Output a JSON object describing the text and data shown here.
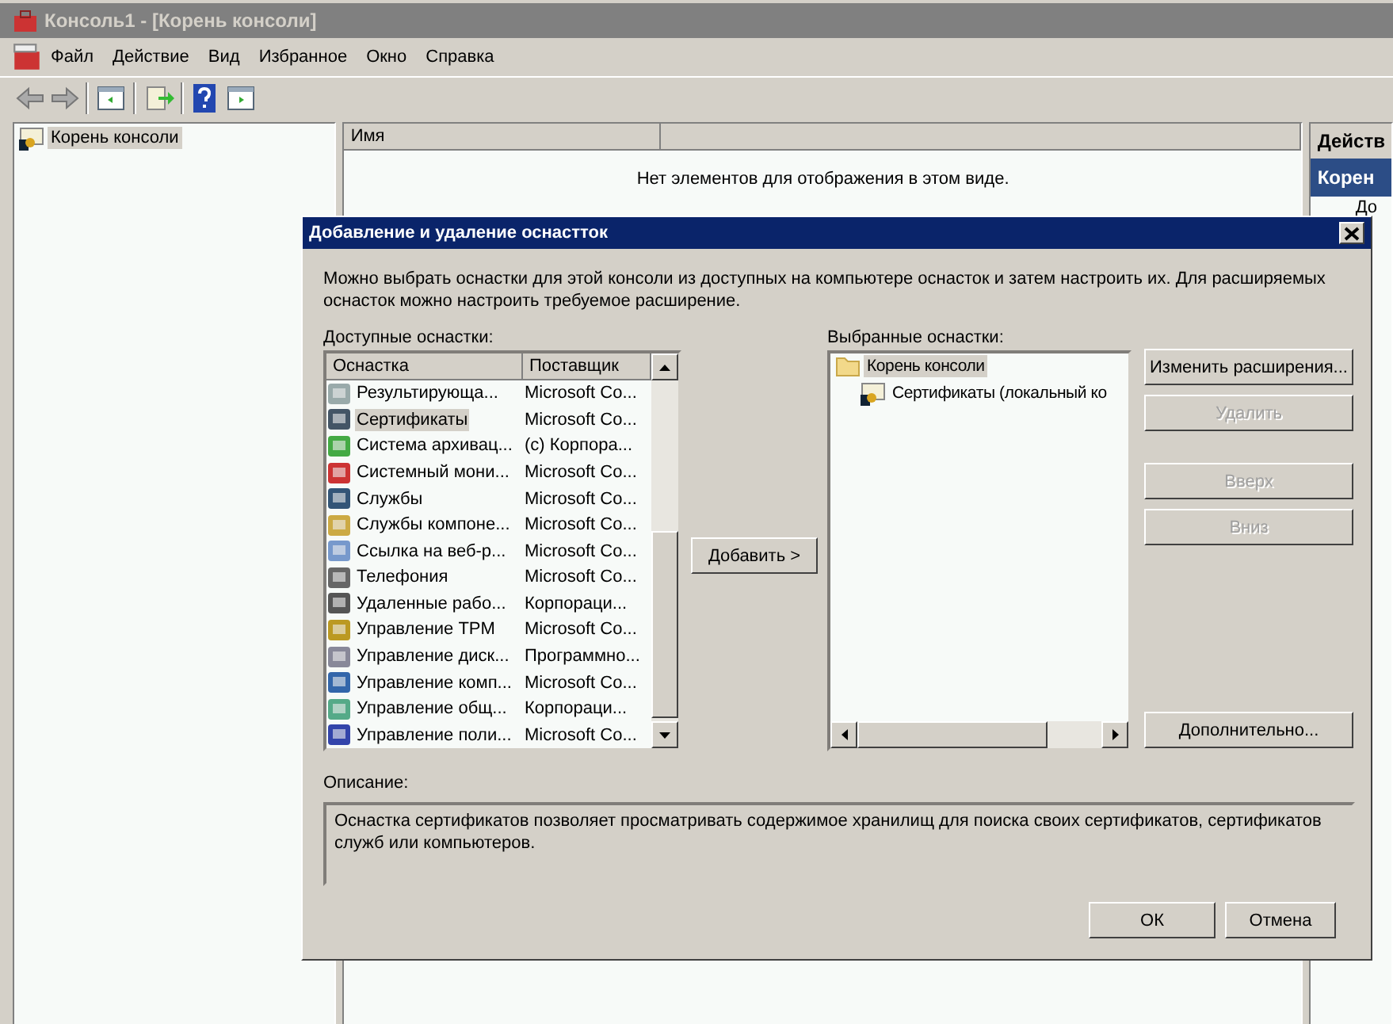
{
  "window": {
    "title": "Консоль1 - [Корень консоли]"
  },
  "menu": [
    "Файл",
    "Действие",
    "Вид",
    "Избранное",
    "Окно",
    "Справка"
  ],
  "tree": [
    {
      "label": "Корень консоли",
      "selected": true
    }
  ],
  "list": {
    "columns": [
      "Имя"
    ],
    "empty_message": "Нет элементов для отображения в этом виде."
  },
  "actions": {
    "title": "Действ",
    "section": "Корен",
    "item": "До"
  },
  "dialog": {
    "title": "Добавление и удаление оснастток",
    "intro": "Можно выбрать оснастки для этой консоли из доступных на компьютере оснасток и затем настроить их. Для расширяемых оснасток можно настроить требуемое расширение.",
    "available_label": "Доступные оснастки:",
    "available_columns": [
      "Оснастка",
      "Поставщик"
    ],
    "available": [
      {
        "name": "Результирующа...",
        "vendor": "Microsoft Co...",
        "selected": false
      },
      {
        "name": "Сертификаты",
        "vendor": "Microsoft Co...",
        "selected": true
      },
      {
        "name": "Система архивац...",
        "vendor": "(c) Корпора...",
        "selected": false
      },
      {
        "name": "Системный мони...",
        "vendor": "Microsoft Co...",
        "selected": false
      },
      {
        "name": "Службы",
        "vendor": "Microsoft Co...",
        "selected": false
      },
      {
        "name": "Службы компоне...",
        "vendor": "Microsoft Co...",
        "selected": false
      },
      {
        "name": "Ссылка на веб-р...",
        "vendor": "Microsoft Co...",
        "selected": false
      },
      {
        "name": "Телефония",
        "vendor": "Microsoft Co...",
        "selected": false
      },
      {
        "name": "Удаленные рабо...",
        "vendor": "Корпораци...",
        "selected": false
      },
      {
        "name": "Управление TPM",
        "vendor": "Microsoft Co...",
        "selected": false
      },
      {
        "name": "Управление диск...",
        "vendor": "Программно...",
        "selected": false
      },
      {
        "name": "Управление комп...",
        "vendor": "Microsoft Co...",
        "selected": false
      },
      {
        "name": "Управление общ...",
        "vendor": "Корпораци...",
        "selected": false
      },
      {
        "name": "Управление поли...",
        "vendor": "Microsoft Co...",
        "selected": false
      }
    ],
    "add_button": "Добавить >",
    "selected_label": "Выбранные оснастки:",
    "selected_tree": [
      {
        "label": "Корень консоли",
        "selected": true,
        "children": [
          {
            "label": "Сертификаты (локальный ко",
            "selected": false
          }
        ]
      }
    ],
    "side_buttons": [
      {
        "label": "Изменить расширения...",
        "disabled": false
      },
      {
        "label": "Удалить",
        "disabled": true
      },
      {
        "label": "Вверх",
        "disabled": true
      },
      {
        "label": "Вниз",
        "disabled": true
      }
    ],
    "advanced_button": "Дополнительно...",
    "description_label": "Описание:",
    "description": "Оснастка сертификатов позволяет просматривать содержимое хранилищ для поиска своих сертификатов, сертификатов служб или компьютеров.",
    "buttons": [
      {
        "label": "ОК"
      },
      {
        "label": "Отмена"
      }
    ]
  }
}
